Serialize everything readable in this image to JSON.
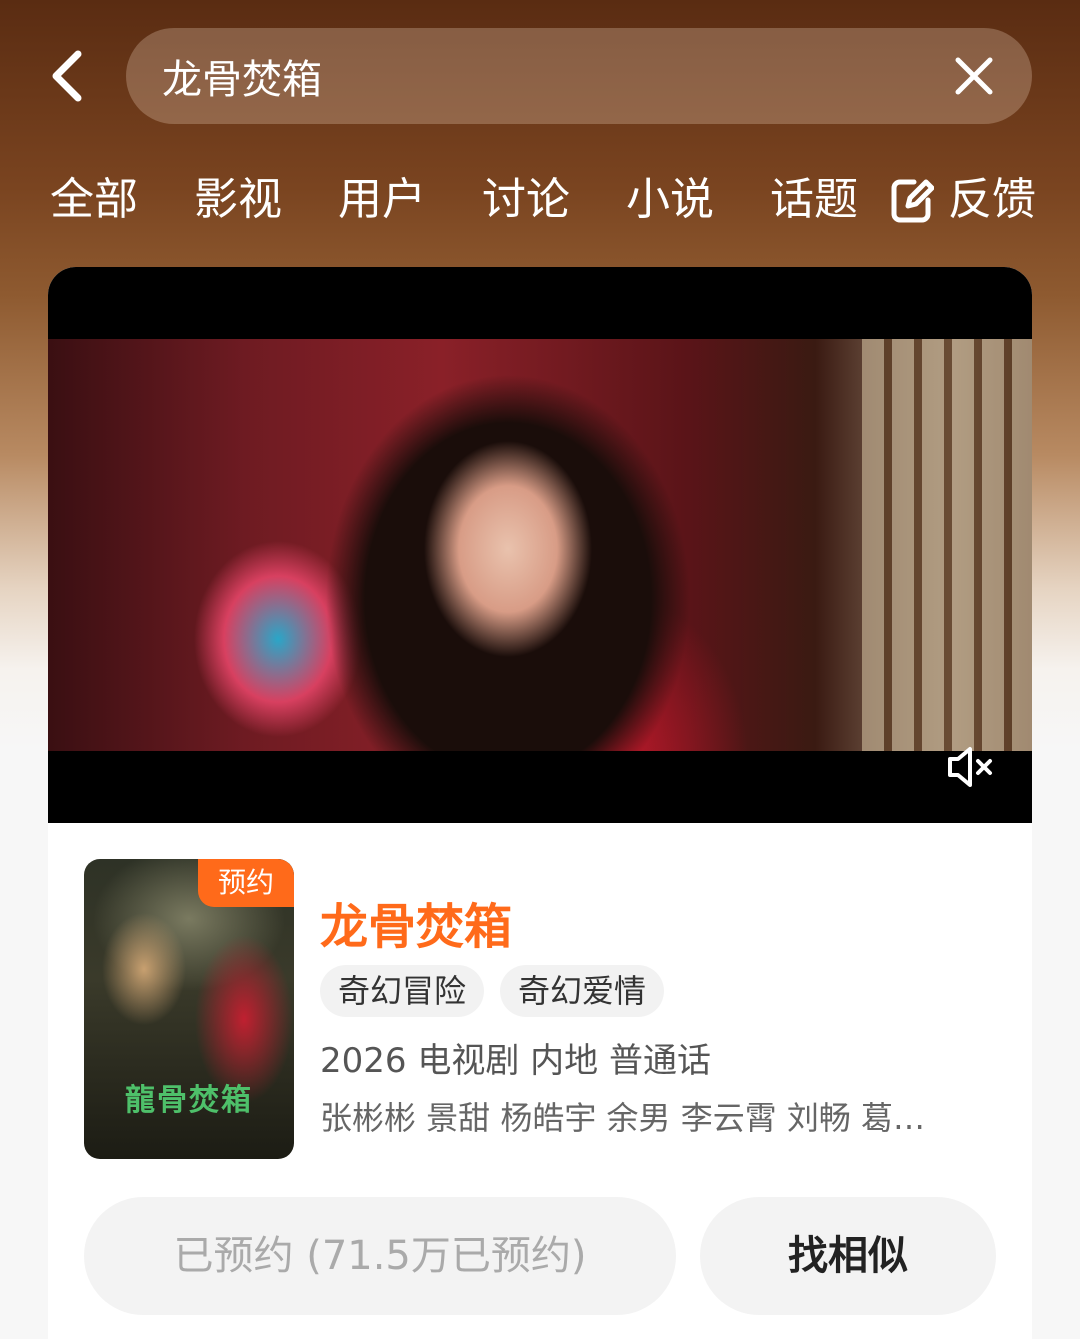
{
  "search": {
    "query": "龙骨焚箱"
  },
  "tabs": [
    {
      "label": "全部"
    },
    {
      "label": "影视"
    },
    {
      "label": "用户"
    },
    {
      "label": "讨论"
    },
    {
      "label": "小说"
    },
    {
      "label": "话题"
    }
  ],
  "feedback": {
    "label": "反馈",
    "icon": "edit-icon"
  },
  "video": {
    "muted": true,
    "icon": "mute-icon"
  },
  "result": {
    "badge": "预约",
    "poster_title": "龍骨焚箱",
    "title": "龙骨焚箱",
    "tags": [
      "奇幻冒险",
      "奇幻爱情"
    ],
    "meta": "2026 电视剧 内地 普通话",
    "cast": "张彬彬 景甜 杨皓宇 余男 李云霄 刘畅 葛…"
  },
  "actions": {
    "reserved_label": "已预约 (71.5万已预约)",
    "similar_label": "找相似"
  },
  "colors": {
    "accent": "#ff6a1a"
  }
}
